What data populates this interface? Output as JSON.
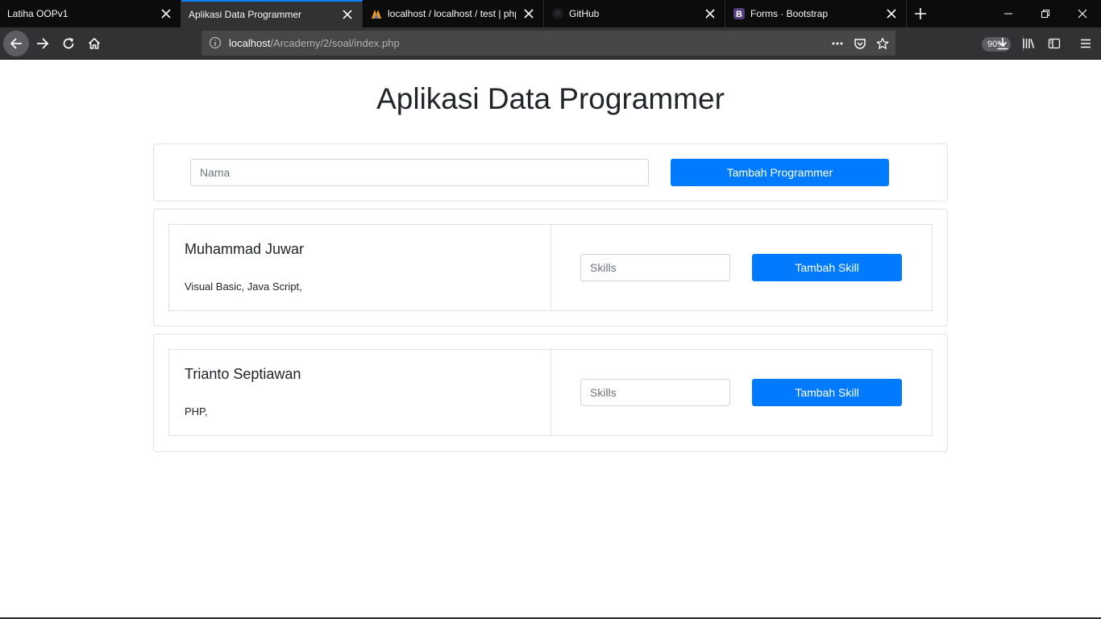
{
  "browser": {
    "tabs": [
      {
        "title": "Latiha OOPv1",
        "active": false,
        "favicon": "none"
      },
      {
        "title": "Aplikasi Data Programmer",
        "active": true,
        "favicon": "none"
      },
      {
        "title": "localhost / localhost / test | phpMyAdmin",
        "active": false,
        "favicon": "phpmyadmin-icon"
      },
      {
        "title": "GitHub",
        "active": false,
        "favicon": "github-icon"
      },
      {
        "title": "Forms · Bootstrap",
        "active": false,
        "favicon": "bootstrap-icon"
      }
    ],
    "url_host": "localhost",
    "url_path": "/Arcademy/2/soal/index.php",
    "zoom": "90%",
    "accent_color": "#0a84ff"
  },
  "page": {
    "title": "Aplikasi Data Programmer",
    "add_form": {
      "name_placeholder": "Nama",
      "name_value": "",
      "submit_label": "Tambah Programmer"
    },
    "programmers": [
      {
        "name": "Muhammad Juwar",
        "skills": "Visual Basic, Java Script,",
        "skill_placeholder": "Skills",
        "skill_button": "Tambah Skill"
      },
      {
        "name": "Trianto Septiawan",
        "skills": "PHP,",
        "skill_placeholder": "Skills",
        "skill_button": "Tambah Skill"
      }
    ],
    "primary_color": "#007bff"
  }
}
